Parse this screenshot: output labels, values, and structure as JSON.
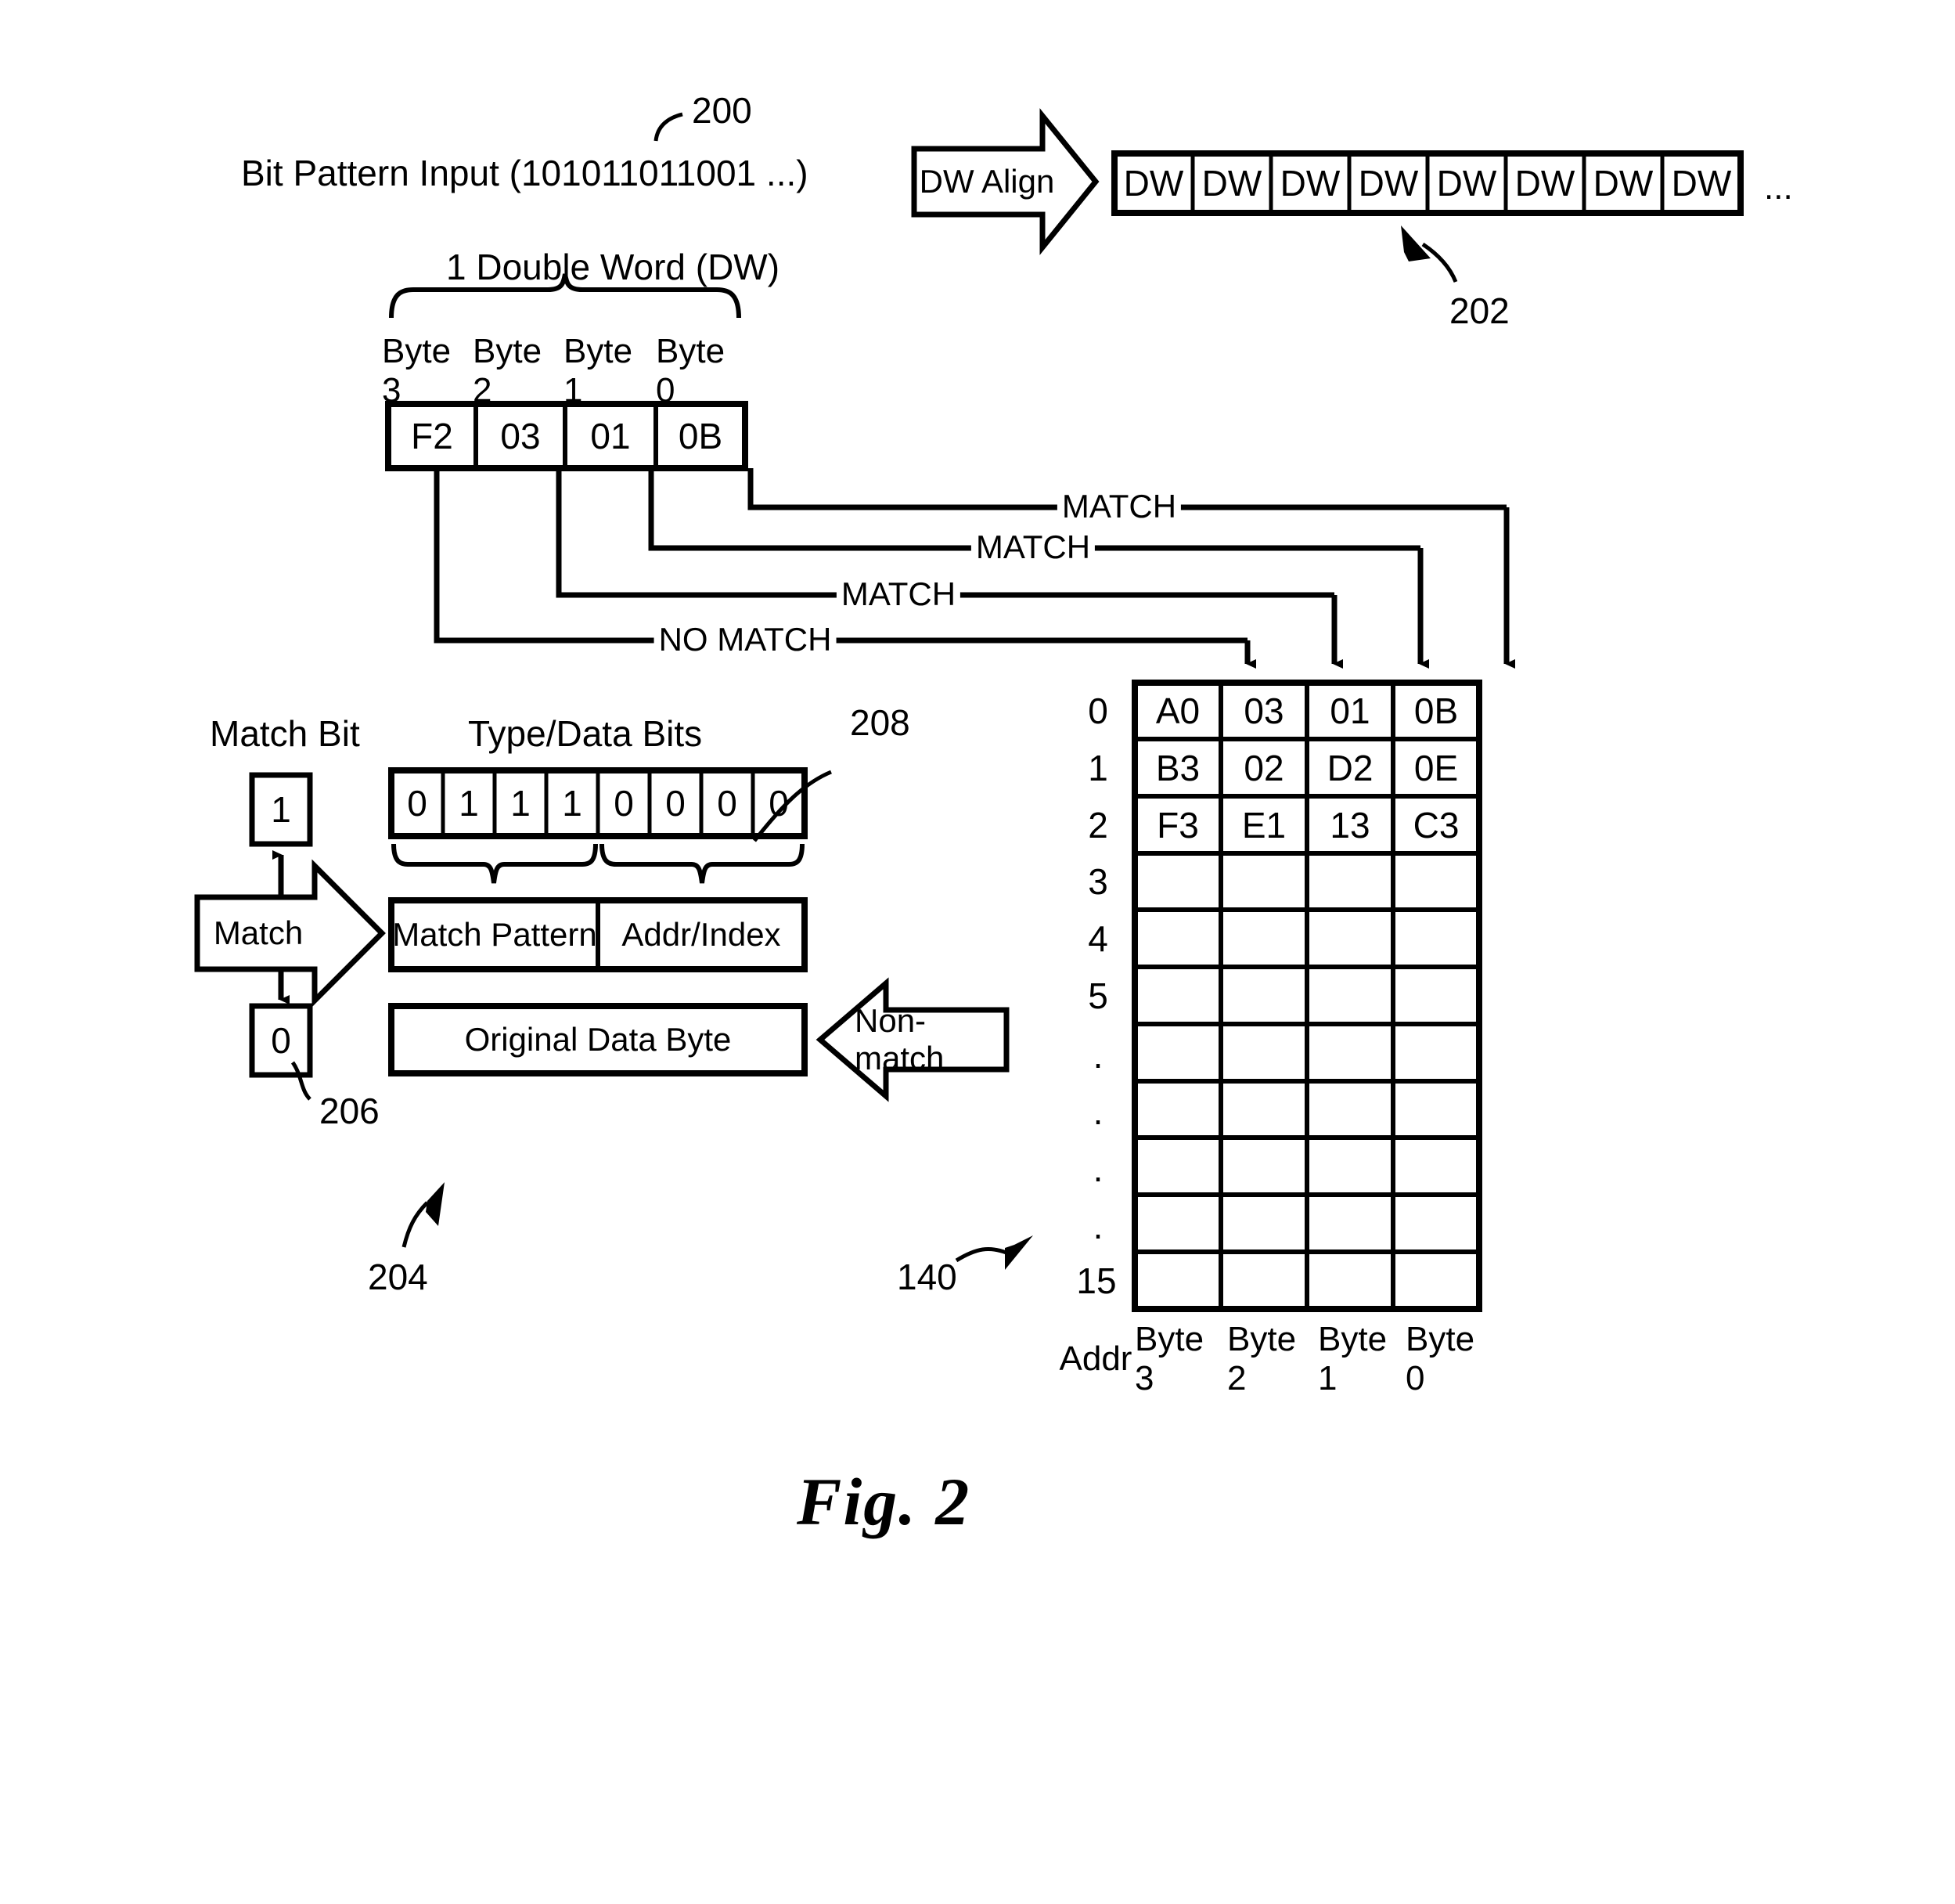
{
  "figure": {
    "caption": "Fig. 2",
    "reference_200": "200",
    "reference_202": "202",
    "reference_204": "204",
    "reference_206": "206",
    "reference_208": "208",
    "reference_140": "140"
  },
  "input_row": {
    "label": "Bit Pattern Input (101011011001 ...)",
    "align_arrow_label": "DW Align",
    "dw_cells": [
      "DW",
      "DW",
      "DW",
      "DW",
      "DW",
      "DW",
      "DW",
      "DW"
    ],
    "ellipsis": "..."
  },
  "double_word": {
    "brace_label": "1 Double Word (DW)",
    "byte_headers": [
      "Byte 3",
      "Byte 2",
      "Byte 1",
      "Byte 0"
    ],
    "byte_values": [
      "F2",
      "03",
      "01",
      "0B"
    ]
  },
  "match_lines": [
    {
      "label": "MATCH",
      "source_byte": "Byte 0"
    },
    {
      "label": "MATCH",
      "source_byte": "Byte 1"
    },
    {
      "label": "MATCH",
      "source_byte": "Byte 2"
    },
    {
      "label": "NO MATCH",
      "source_byte": "Byte 3"
    }
  ],
  "encoding": {
    "match_bit_title": "Match Bit",
    "type_data_bits_title": "Type/Data Bits",
    "match_bit_one": "1",
    "match_bit_zero": "0",
    "bits": [
      "0",
      "1",
      "1",
      "1",
      "0",
      "0",
      "0",
      "0"
    ],
    "match_arrow_label": "Match",
    "nonmatch_arrow_label": "Non-match",
    "match_pattern_label": "Match Pattern",
    "addr_index_label": "Addr/Index",
    "original_data_byte_label": "Original Data Byte"
  },
  "table": {
    "column_footers": [
      "Addr",
      "Byte 3",
      "Byte 2",
      "Byte 1",
      "Byte 0"
    ],
    "row_labels": [
      "0",
      "1",
      "2",
      "3",
      "4",
      "5",
      ".",
      ".",
      ".",
      ".",
      "15"
    ],
    "rows": [
      [
        "A0",
        "03",
        "01",
        "0B"
      ],
      [
        "B3",
        "02",
        "D2",
        "0E"
      ],
      [
        "F3",
        "E1",
        "13",
        "C3"
      ],
      [
        "",
        "",
        "",
        ""
      ],
      [
        "",
        "",
        "",
        ""
      ],
      [
        "",
        "",
        "",
        ""
      ],
      [
        "",
        "",
        "",
        ""
      ],
      [
        "",
        "",
        "",
        ""
      ],
      [
        "",
        "",
        "",
        ""
      ],
      [
        "",
        "",
        "",
        ""
      ],
      [
        "",
        "",
        "",
        ""
      ]
    ]
  },
  "colors": {
    "ink": "#000000",
    "paper": "#ffffff"
  }
}
